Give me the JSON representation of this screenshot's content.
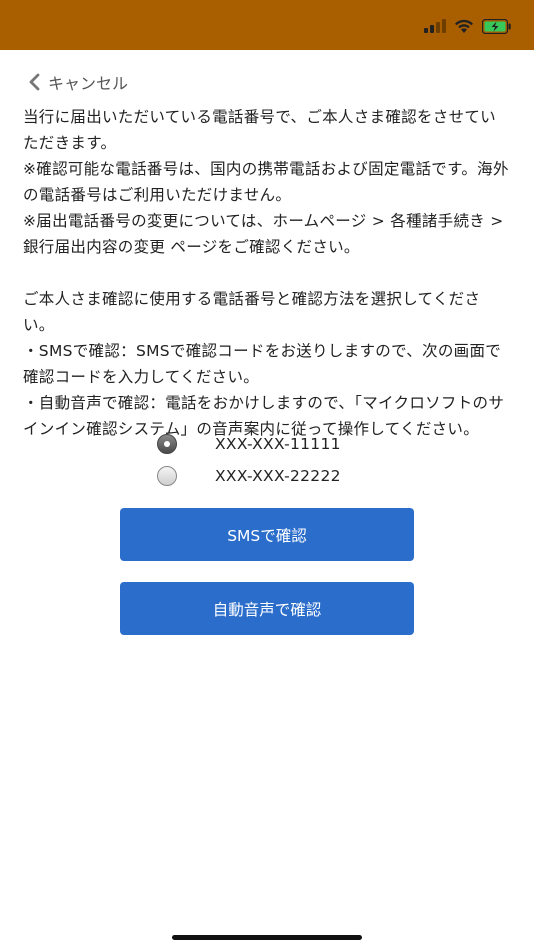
{
  "status_bar": {
    "bg_color": "#a95e00",
    "icons": [
      "cellular-signal-icon",
      "wifi-icon",
      "battery-charging-icon"
    ]
  },
  "nav": {
    "back_label": "キャンセル"
  },
  "message": {
    "paragraphs": [
      "当行に届出いただいている電話番号で、ご本人さま確認をさせていただきます。",
      "※確認可能な電話番号は、国内の携帯電話および固定電話です。海外の電話番号はご利用いただけません。",
      "※届出電話番号の変更については、ホームページ > 各種諸手続き > 銀行届出内容の変更 ページをご確認ください。",
      "",
      "ご本人さま確認に使用する電話番号と確認方法を選択してください。",
      "・SMSで確認：SMSで確認コードをお送りしますので、次の画面で確認コードを入力してください。",
      "・自動音声で確認：電話をおかけしますので、「マイクロソフトのサインイン確認システム」の音声案内に従って操作してください。"
    ]
  },
  "phones": {
    "options": [
      {
        "number": "XXX-XXX-11111",
        "selected": true
      },
      {
        "number": "XXX-XXX-22222",
        "selected": false
      }
    ]
  },
  "actions": {
    "sms_label": "SMSで確認",
    "voice_label": "自動音声で確認",
    "button_color": "#2a6dcb"
  }
}
